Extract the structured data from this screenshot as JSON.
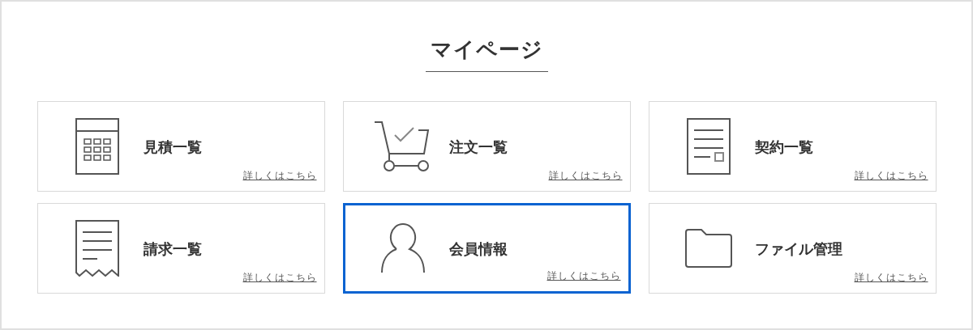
{
  "title": "マイページ",
  "cards": [
    {
      "kind": "calculator",
      "label": "見積一覧",
      "link": "詳しくはこちら",
      "selected": false
    },
    {
      "kind": "cart",
      "label": "注文一覧",
      "link": "詳しくはこちら",
      "selected": false
    },
    {
      "kind": "document",
      "label": "契約一覧",
      "link": "詳しくはこちら",
      "selected": false
    },
    {
      "kind": "receipt",
      "label": "請求一覧",
      "link": "詳しくはこちら",
      "selected": false
    },
    {
      "kind": "person",
      "label": "会員情報",
      "link": "詳しくはこちら",
      "selected": true
    },
    {
      "kind": "folder",
      "label": "ファイル管理",
      "link": "詳しくはこちら",
      "selected": false
    }
  ]
}
